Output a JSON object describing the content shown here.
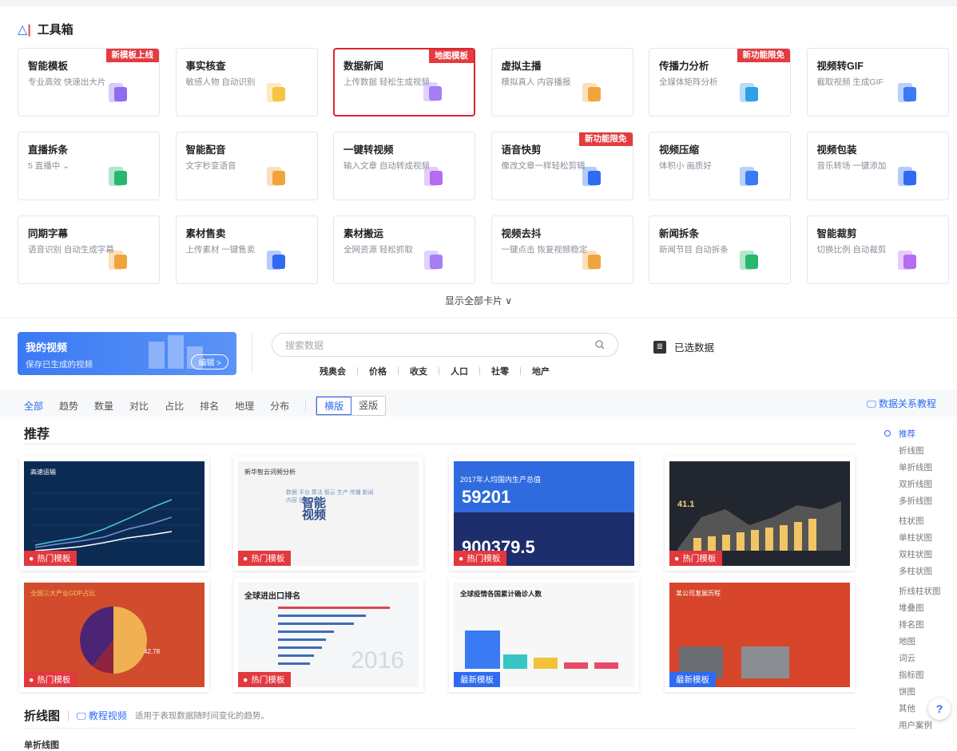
{
  "toolbox": {
    "logo": "△",
    "title": "工具箱"
  },
  "cards": [
    {
      "title": "智能模板",
      "desc": "专业高效 快速出大片",
      "badge": "新模板上线",
      "icon": "template-icon",
      "color": "#8f6cf2"
    },
    {
      "title": "事实核查",
      "desc": "敏感人物 自动识别",
      "badge": "",
      "icon": "fact-check-icon",
      "color": "#f6c344"
    },
    {
      "title": "数据新闻",
      "desc": "上传数据 轻松生成视频",
      "badge": "地图模板",
      "icon": "data-news-icon",
      "color": "#a57df5"
    },
    {
      "title": "虚拟主播",
      "desc": "模拟真人 内容播报",
      "badge": "",
      "icon": "virtual-anchor-icon",
      "color": "#f0a53c"
    },
    {
      "title": "传播力分析",
      "desc": "全媒体矩阵分析",
      "badge": "新功能限免",
      "icon": "analysis-icon",
      "color": "#2f9fe8"
    },
    {
      "title": "视频转GIF",
      "desc": "截取视频 生成GIF",
      "badge": "",
      "icon": "gif-icon",
      "color": "#3a7af3"
    },
    {
      "title": "直播拆条",
      "desc": "5 直播中 ⌄",
      "badge": "",
      "icon": "live-split-icon",
      "color": "#29b76b"
    },
    {
      "title": "智能配音",
      "desc": "文字秒变语音",
      "badge": "",
      "icon": "dubbing-icon",
      "color": "#f0a53c"
    },
    {
      "title": "一键转视频",
      "desc": "输入文章 自动转成视频",
      "badge": "",
      "icon": "article-video-icon",
      "color": "#b46cf2"
    },
    {
      "title": "语音快剪",
      "desc": "像改文章一样轻松剪辑",
      "badge": "新功能限免",
      "icon": "voice-cut-icon",
      "color": "#2f6bf2"
    },
    {
      "title": "视频压缩",
      "desc": "体积小 画质好",
      "badge": "",
      "icon": "compress-icon",
      "color": "#3a7af3"
    },
    {
      "title": "视频包装",
      "desc": "音乐转场 一键添加",
      "badge": "",
      "icon": "package-icon",
      "color": "#2f6bf2"
    },
    {
      "title": "同期字幕",
      "desc": "语音识别 自动生成字幕",
      "badge": "",
      "icon": "subtitle-icon",
      "color": "#f0a53c"
    },
    {
      "title": "素材售卖",
      "desc": "上传素材 一键售卖",
      "badge": "",
      "icon": "material-sell-icon",
      "color": "#2f6bf2"
    },
    {
      "title": "素材搬运",
      "desc": "全网资源 轻松抓取",
      "badge": "",
      "icon": "material-move-icon",
      "color": "#a57df5"
    },
    {
      "title": "视频去抖",
      "desc": "一键点击 恢复视频稳定",
      "badge": "",
      "icon": "stabilize-icon",
      "color": "#f0a53c"
    },
    {
      "title": "新闻拆条",
      "desc": "新闻节目 自动拆条",
      "badge": "",
      "icon": "news-split-icon",
      "color": "#29b76b"
    },
    {
      "title": "智能裁剪",
      "desc": "切换比例 自动裁剪",
      "badge": "",
      "icon": "crop-icon",
      "color": "#b46cf2"
    }
  ],
  "show_all": "显示全部卡片 ∨",
  "my_video": {
    "title": "我的视频",
    "desc": "保存已生成的视频",
    "edit": "编辑 >"
  },
  "search": {
    "placeholder": "搜索数据"
  },
  "quick_tags": [
    "残奥会",
    "价格",
    "收支",
    "人口",
    "社零",
    "地产"
  ],
  "selected_data": "已选数据",
  "filters": [
    "全部",
    "趋势",
    "数量",
    "对比",
    "占比",
    "排名",
    "地理",
    "分布"
  ],
  "orientation": [
    "横版",
    "竖版"
  ],
  "tutorial_link": "数据关系教程",
  "recommend_title": "推荐",
  "templates": [
    {
      "tag": "热门模板",
      "tagType": "hot",
      "caption": "高速运输"
    },
    {
      "tag": "热门模板",
      "tagType": "hot",
      "caption": "新华智云词频分析"
    },
    {
      "tag": "热门模板",
      "tagType": "hot",
      "caption": "2017年人均国内生产总值",
      "num": "59201",
      "num2": "900379.5"
    },
    {
      "tag": "热门模板",
      "tagType": "hot",
      "caption": "",
      "num": "41.1"
    },
    {
      "tag": "热门模板",
      "tagType": "hot",
      "caption": "全国三大产业GDP占比",
      "num": "42.78"
    },
    {
      "tag": "热门模板",
      "tagType": "hot",
      "caption": "全球进出口排名",
      "num": "2016"
    },
    {
      "tag": "最新模板",
      "tagType": "new",
      "caption": "全球疫情各国累计确诊人数"
    },
    {
      "tag": "最新模板",
      "tagType": "new",
      "caption": "某公司发展历程"
    }
  ],
  "sidebar": [
    {
      "label": "推荐",
      "active": true,
      "group": false
    },
    {
      "label": "折线图",
      "active": false,
      "group": false
    },
    {
      "label": "单折线图",
      "active": false,
      "group": false
    },
    {
      "label": "双折线图",
      "active": false,
      "group": false
    },
    {
      "label": "多折线图",
      "active": false,
      "group": false
    },
    {
      "label": "柱状图",
      "active": false,
      "group": true
    },
    {
      "label": "单柱状图",
      "active": false,
      "group": false
    },
    {
      "label": "双柱状图",
      "active": false,
      "group": false
    },
    {
      "label": "多柱状图",
      "active": false,
      "group": false
    },
    {
      "label": "折线柱状图",
      "active": false,
      "group": true
    },
    {
      "label": "堆叠图",
      "active": false,
      "group": false
    },
    {
      "label": "排名图",
      "active": false,
      "group": false
    },
    {
      "label": "地图",
      "active": false,
      "group": false
    },
    {
      "label": "词云",
      "active": false,
      "group": false
    },
    {
      "label": "指标图",
      "active": false,
      "group": false
    },
    {
      "label": "饼图",
      "active": false,
      "group": false
    },
    {
      "label": "其他",
      "active": false,
      "group": false
    },
    {
      "label": "用户案例",
      "active": false,
      "group": false
    }
  ],
  "line_section": {
    "title": "折线图",
    "tutorial": "教程视频",
    "desc": "适用于表现数据随时间变化的趋势。",
    "sub": "单折线图"
  },
  "help": "?"
}
